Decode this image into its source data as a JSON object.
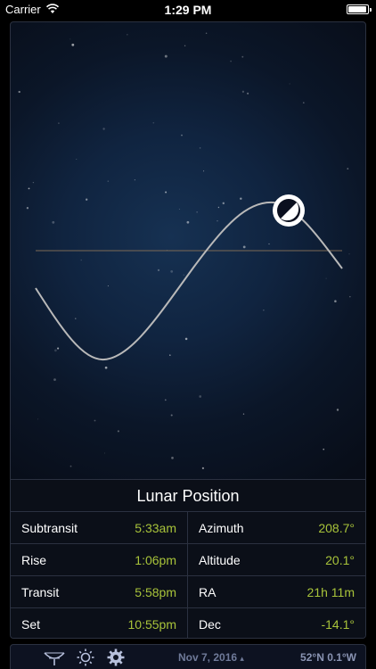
{
  "status_bar": {
    "carrier": "Carrier",
    "time": "1:29 PM",
    "battery_level": 0.95
  },
  "sky": {
    "moon_phase_icon": "half-moon-icon"
  },
  "lunar_position": {
    "title": "Lunar Position",
    "left_rows": [
      {
        "label": "Subtransit",
        "value": "5:33am"
      },
      {
        "label": "Rise",
        "value": "1:06pm"
      },
      {
        "label": "Transit",
        "value": "5:58pm"
      },
      {
        "label": "Set",
        "value": "10:55pm"
      }
    ],
    "right_rows": [
      {
        "label": "Azimuth",
        "value": "208.7°"
      },
      {
        "label": "Altitude",
        "value": "20.1°"
      },
      {
        "label": "RA",
        "value": "21h 11m"
      },
      {
        "label": "Dec",
        "value": "-14.1°"
      }
    ],
    "value_color": "#a8c33a"
  },
  "toolbar": {
    "icons": [
      "moon-icon",
      "telescope-icon",
      "sun-icon",
      "gear-icon"
    ],
    "date": "Nov 7, 2016",
    "date_arrow": "▴",
    "coordinates": "52°N  0.1°W"
  }
}
